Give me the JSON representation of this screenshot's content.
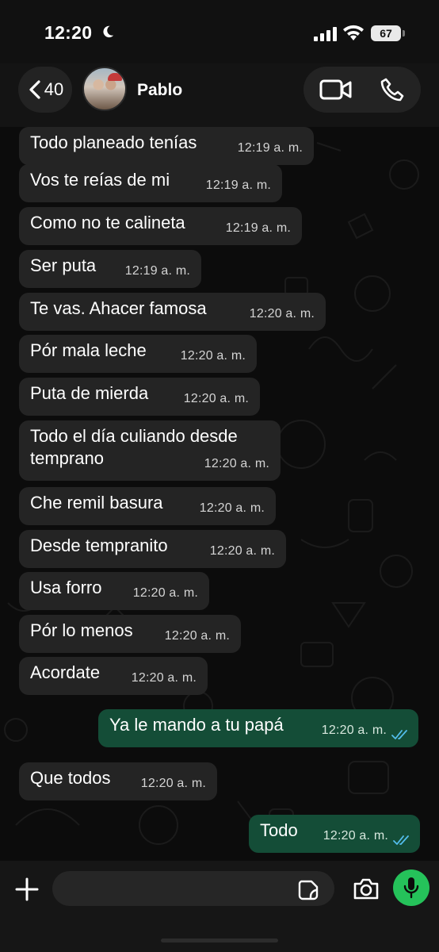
{
  "status_bar": {
    "time": "12:20",
    "battery": "67"
  },
  "header": {
    "back_count": "40",
    "contact_name": "Pablo"
  },
  "messages": [
    {
      "dir": "in",
      "text": "Todo planeado tenías",
      "time": "12:19 a. m."
    },
    {
      "dir": "in",
      "text": "Vos te reías de mi",
      "time": "12:19 a. m."
    },
    {
      "dir": "in",
      "text": "Como no te calineta",
      "time": "12:19 a. m."
    },
    {
      "dir": "in",
      "text": "Ser puta",
      "time": "12:19 a. m."
    },
    {
      "dir": "in",
      "text": "Te vas. Ahacer famosa",
      "time": "12:20 a. m."
    },
    {
      "dir": "in",
      "text": "Pór mala leche",
      "time": "12:20 a. m."
    },
    {
      "dir": "in",
      "text": "Puta de mierda",
      "time": "12:20 a. m."
    },
    {
      "dir": "in",
      "text": "Todo el día culiando desde\ntemprano",
      "time": "12:20 a. m."
    },
    {
      "dir": "in",
      "text": "Che remil basura",
      "time": "12:20 a. m."
    },
    {
      "dir": "in",
      "text": "Desde tempranito",
      "time": "12:20 a. m."
    },
    {
      "dir": "in",
      "text": "Usa forro",
      "time": "12:20 a. m."
    },
    {
      "dir": "in",
      "text": "Pór lo menos",
      "time": "12:20 a. m."
    },
    {
      "dir": "in",
      "text": "Acordate",
      "time": "12:20 a. m."
    },
    {
      "dir": "out",
      "text": "Ya le mando a tu papá",
      "time": "12:20 a. m.",
      "status": "read"
    },
    {
      "dir": "in",
      "text": "Que todos",
      "time": "12:20 a. m."
    },
    {
      "dir": "out",
      "text": "Todo",
      "time": "12:20 a. m.",
      "status": "read"
    }
  ],
  "input": {
    "placeholder": ""
  },
  "colors": {
    "incoming_bubble": "#242424",
    "outgoing_bubble": "#144d37",
    "read_ticks": "#53bdeb",
    "mic_button": "#25c25a"
  },
  "icons": {
    "back": "chevron-left-icon",
    "video": "video-camera-icon",
    "phone": "phone-icon",
    "plus": "plus-icon",
    "sticker": "sticker-icon",
    "camera": "camera-icon",
    "mic": "microphone-icon"
  }
}
